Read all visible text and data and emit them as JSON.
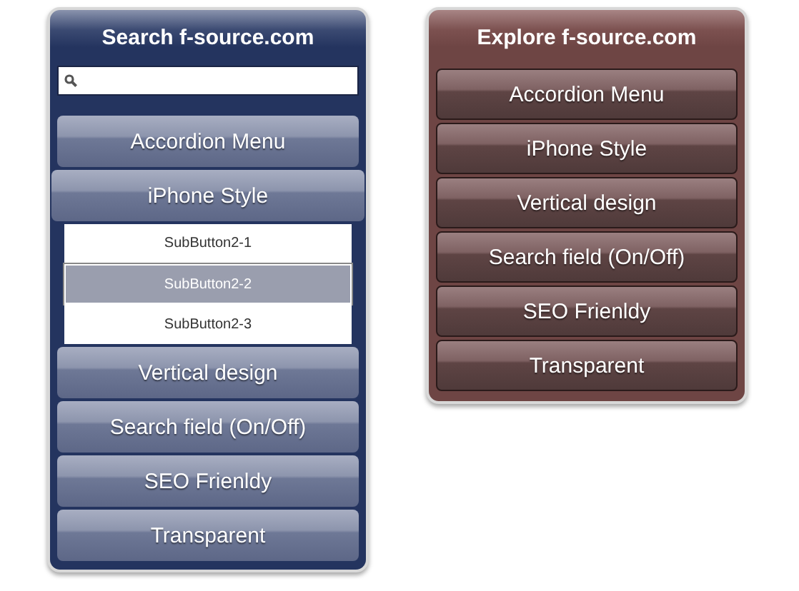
{
  "menus": [
    {
      "kind": "blue",
      "title": "Search f-source.com",
      "search_field": true,
      "items": [
        {
          "label": "Accordion Menu",
          "expanded": false
        },
        {
          "label": "iPhone Style",
          "expanded": true,
          "children": [
            {
              "label": "SubButton2-1",
              "selected": false
            },
            {
              "label": "SubButton2-2",
              "selected": true
            },
            {
              "label": "SubButton2-3",
              "selected": false
            }
          ]
        },
        {
          "label": "Vertical design",
          "expanded": false
        },
        {
          "label": "Search field (On/Off)",
          "expanded": false
        },
        {
          "label": "SEO Frienldy",
          "expanded": false
        },
        {
          "label": "Transparent",
          "expanded": false
        }
      ]
    },
    {
      "kind": "maroon",
      "title": "Explore f-source.com",
      "items": [
        {
          "label": "Accordion Menu",
          "expanded": false
        },
        {
          "label": "iPhone Style",
          "expanded": false
        },
        {
          "label": "Vertical design",
          "expanded": false
        },
        {
          "label": "Search field (On/Off)",
          "expanded": false
        },
        {
          "label": "SEO Frienldy",
          "expanded": false
        },
        {
          "label": "Transparent",
          "expanded": false
        }
      ]
    }
  ]
}
